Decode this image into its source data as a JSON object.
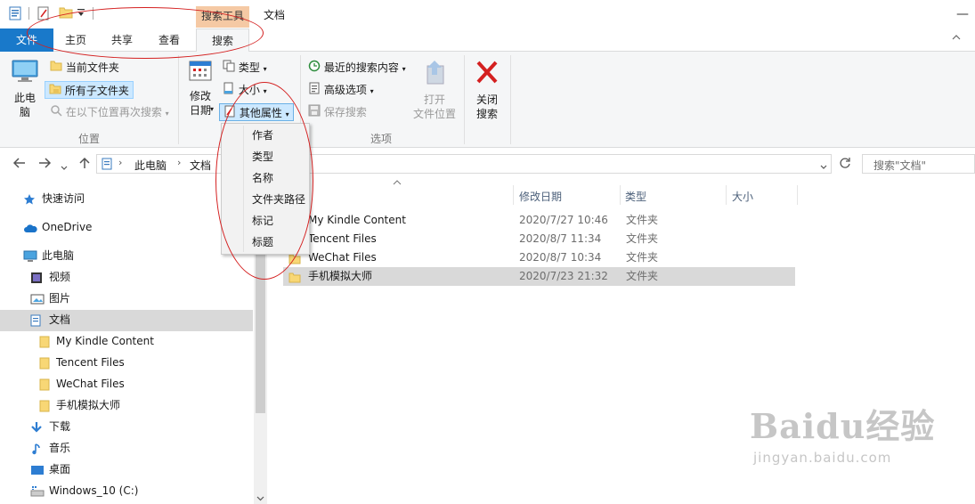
{
  "window": {
    "title": "文档",
    "context_tab": "搜索工具"
  },
  "tabs": [
    {
      "label": "文件"
    },
    {
      "label": "主页"
    },
    {
      "label": "共享"
    },
    {
      "label": "查看"
    },
    {
      "label": "搜索"
    }
  ],
  "ribbon": {
    "location_group": {
      "label": "位置",
      "this_pc_label": "此电\n脑",
      "current_folder": "当前文件夹",
      "all_subfolders": "所有子文件夹",
      "search_again": "在以下位置再次搜索"
    },
    "refine_group": {
      "date_modified": "修改\n日期",
      "type": "类型",
      "size": "大小",
      "other_properties": "其他属性"
    },
    "options_group": {
      "label": "选项",
      "recent_searches": "最近的搜索内容",
      "advanced_options": "高级选项",
      "save_search": "保存搜索",
      "open_location": "打开\n文件位置"
    },
    "close_group": {
      "close_search": "关闭\n搜索"
    }
  },
  "properties_menu": [
    "作者",
    "类型",
    "名称",
    "文件夹路径",
    "标记",
    "标题"
  ],
  "address_bar": {
    "crumbs": [
      "此电脑",
      "文档"
    ]
  },
  "search": {
    "placeholder": "搜索\"文档\""
  },
  "nav_pane": [
    {
      "label": "快速访问",
      "icon": "star-icon"
    },
    {
      "label": "OneDrive",
      "icon": "cloud-icon"
    },
    {
      "label": "此电脑",
      "icon": "computer-icon"
    },
    {
      "label": "视频",
      "icon": "video-icon"
    },
    {
      "label": "图片",
      "icon": "picture-icon"
    },
    {
      "label": "文档",
      "icon": "document-icon"
    },
    {
      "label": "My Kindle Content",
      "icon": "folder-icon"
    },
    {
      "label": "Tencent Files",
      "icon": "folder-icon"
    },
    {
      "label": "WeChat Files",
      "icon": "folder-icon"
    },
    {
      "label": "手机模拟大师",
      "icon": "folder-icon"
    },
    {
      "label": "下载",
      "icon": "download-icon"
    },
    {
      "label": "音乐",
      "icon": "music-icon"
    },
    {
      "label": "桌面",
      "icon": "desktop-icon"
    },
    {
      "label": "Windows_10 (C:)",
      "icon": "drive-icon"
    }
  ],
  "columns": {
    "date": "修改日期",
    "type": "类型",
    "size": "大小"
  },
  "files": [
    {
      "name": "My Kindle Content",
      "date": "2020/7/27 10:46",
      "type": "文件夹"
    },
    {
      "name": "Tencent Files",
      "date": "2020/8/7 11:34",
      "type": "文件夹"
    },
    {
      "name": "WeChat Files",
      "date": "2020/8/7 10:34",
      "type": "文件夹"
    },
    {
      "name": "手机模拟大师",
      "date": "2020/7/23 21:32",
      "type": "文件夹"
    }
  ],
  "watermark": {
    "brand": "Baidu经验",
    "url": "jingyan.baidu.com"
  },
  "colors": {
    "accent": "#1979ca",
    "context_tab": "#f5c9a4",
    "annotation": "#d42020",
    "selection": "#cce8ff"
  }
}
